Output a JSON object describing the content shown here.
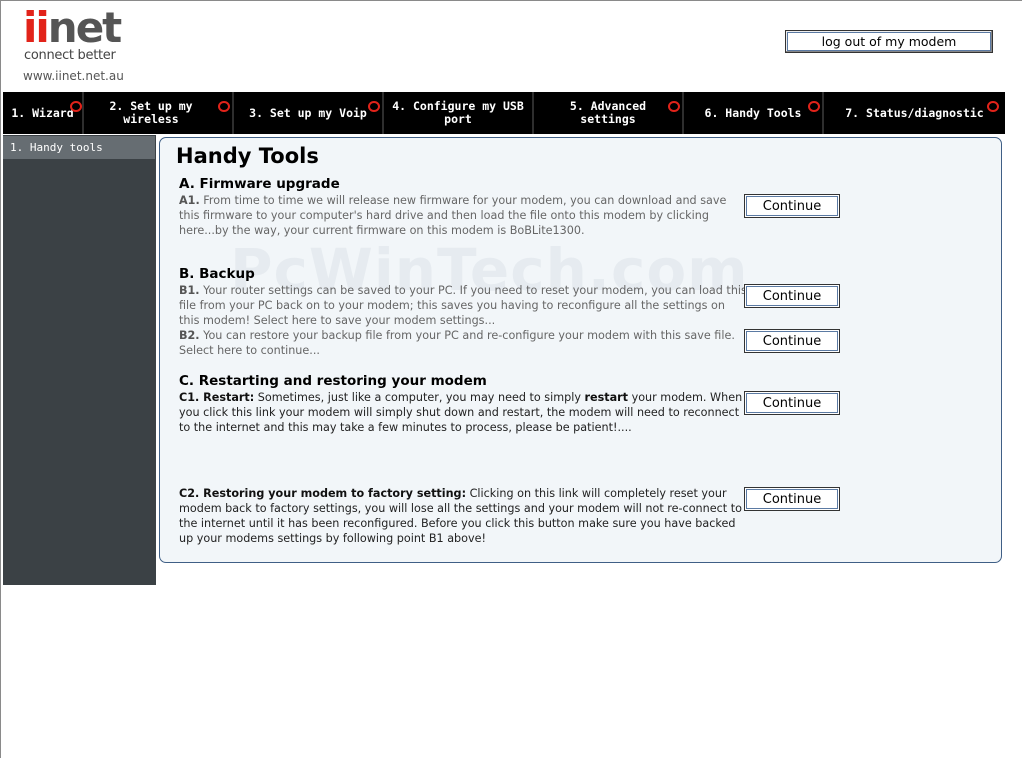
{
  "brand": {
    "logo_ii": "ii",
    "logo_net": "net",
    "tagline": "connect better",
    "url": "www.iinet.net.au"
  },
  "header": {
    "logout_label": "log out of my modem"
  },
  "nav": {
    "items": [
      {
        "label": "1. Wizard"
      },
      {
        "label": "2. Set up my wireless"
      },
      {
        "label": "3. Set up my Voip"
      },
      {
        "label": "4. Configure my USB port"
      },
      {
        "label": "5. Advanced settings"
      },
      {
        "label": "6. Handy Tools"
      },
      {
        "label": "7. Status/diagnostic"
      }
    ]
  },
  "sidebar": {
    "items": [
      {
        "label": "1. Handy tools"
      }
    ]
  },
  "main": {
    "title": "Handy Tools",
    "watermark": "PcWinTech.com",
    "sections": {
      "a": {
        "title": "A. Firmware upgrade",
        "a1_prefix": "A1.",
        "a1_text": " From time to time we will release new firmware for your modem, you can download and save this firmware to your computer's hard drive and then load the file onto this modem by clicking here...by the way, your current firmware on this modem is BoBLite1300."
      },
      "b": {
        "title": "B. Backup",
        "b1_prefix": "B1.",
        "b1_text": " Your router settings can be saved to your PC. If you need to reset your modem, you can load this file from your PC back on to your modem; this saves you having to reconfigure all the settings on this modem! Select here to save your modem settings...",
        "b2_prefix": "B2.",
        "b2_text": " You can restore your backup file from your PC and re-configure your modem with this save file. Select here to continue..."
      },
      "c": {
        "title": "C. Restarting and restoring your modem",
        "c1_prefix": "C1. Restart:",
        "c1_text_a": " Sometimes, just like a computer, you may need to simply ",
        "c1_bold": "restart",
        "c1_text_b": " your modem. When you click this link your modem will simply shut down and restart, the modem will need to reconnect to the internet and this may take a few minutes to process, please be patient!....",
        "c2_prefix": "C2. Restoring your modem to factory setting:",
        "c2_text": " Clicking on this link will completely reset your modem back to factory settings, you will lose all the settings and your modem will not re-connect to the internet until it has been reconfigured. Before you click this button make sure you have backed up your modems settings by following point B1 above!"
      }
    },
    "continue_label": "Continue"
  },
  "colors": {
    "brand_red": "#e2231a",
    "nav_bg": "#000000",
    "sidebar_bg": "#3b4145",
    "panel_border": "#3f5f86"
  }
}
